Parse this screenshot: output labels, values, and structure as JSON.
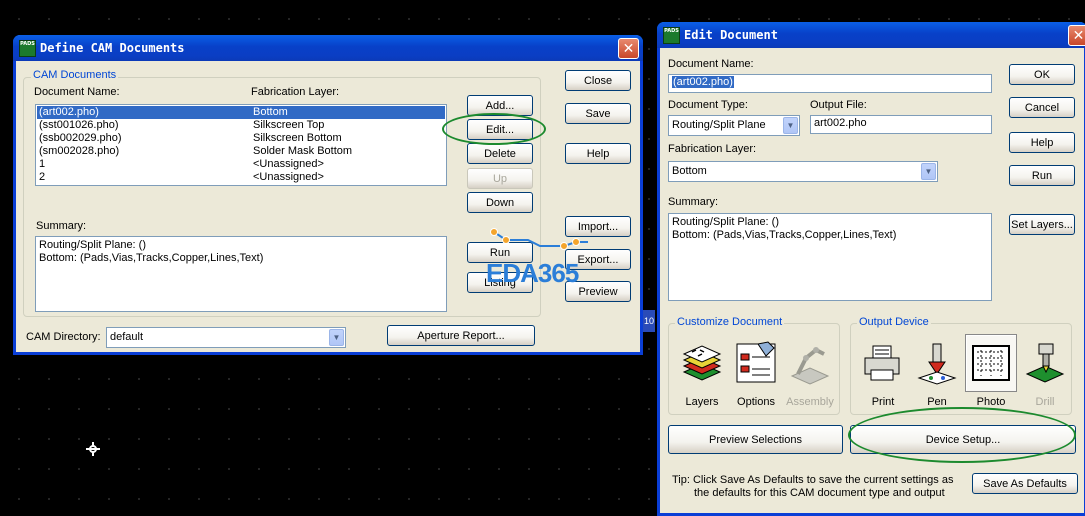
{
  "define_cam": {
    "title": "Define CAM Documents",
    "app_icon_text": "PADS",
    "group_label": "CAM Documents",
    "col_doc_name": "Document Name:",
    "col_fab_layer": "Fabrication Layer:",
    "rows": [
      {
        "name": "(art002.pho)",
        "layer": "Bottom",
        "selected": true
      },
      {
        "name": "(sst001026.pho)",
        "layer": "Silkscreen Top",
        "selected": false
      },
      {
        "name": "(ssb002029.pho)",
        "layer": "Silkscreen Bottom",
        "selected": false
      },
      {
        "name": "(sm002028.pho)",
        "layer": "Solder Mask Bottom",
        "selected": false
      },
      {
        "name": "1",
        "layer": "<Unassigned>",
        "selected": false
      },
      {
        "name": "2",
        "layer": "<Unassigned>",
        "selected": false
      }
    ],
    "summary_label": "Summary:",
    "summary_lines": "Routing/Split Plane: ()\nBottom: (Pads,Vias,Tracks,Copper,Lines,Text)",
    "cam_dir_label": "CAM Directory:",
    "cam_dir_value": "default",
    "buttons": {
      "add": "Add...",
      "edit": "Edit...",
      "delete": "Delete",
      "up": "Up",
      "down": "Down",
      "run": "Run",
      "listing": "Listing",
      "close": "Close",
      "save": "Save",
      "help": "Help",
      "import": "Import...",
      "export": "Export...",
      "preview": "Preview",
      "aperture_report": "Aperture Report..."
    }
  },
  "edit_doc": {
    "title": "Edit Document",
    "doc_name_label": "Document Name:",
    "doc_name_value": "(art002.pho)",
    "doc_type_label": "Document Type:",
    "doc_type_value": "Routing/Split Plane",
    "output_file_label": "Output File:",
    "output_file_value": "art002.pho",
    "fab_layer_label": "Fabrication Layer:",
    "fab_layer_value": "Bottom",
    "summary_label": "Summary:",
    "summary_lines": "Routing/Split Plane: ()\nBottom: (Pads,Vias,Tracks,Copper,Lines,Text)",
    "customize_label": "Customize Document",
    "output_device_label": "Output Device",
    "customize_items": [
      "Layers",
      "Options",
      "Assembly"
    ],
    "device_items": [
      "Print",
      "Pen",
      "Photo",
      "Drill"
    ],
    "buttons": {
      "ok": "OK",
      "cancel": "Cancel",
      "help": "Help",
      "run": "Run",
      "set_layers": "Set Layers...",
      "preview_selections": "Preview Selections",
      "device_setup": "Device Setup...",
      "save_as_defaults": "Save As Defaults"
    },
    "tip_line1": "Tip: Click Save As Defaults to save the current settings as",
    "tip_line2": "the defaults for this CAM document type and output"
  },
  "watermark": "EDA365",
  "marker_text": "10"
}
